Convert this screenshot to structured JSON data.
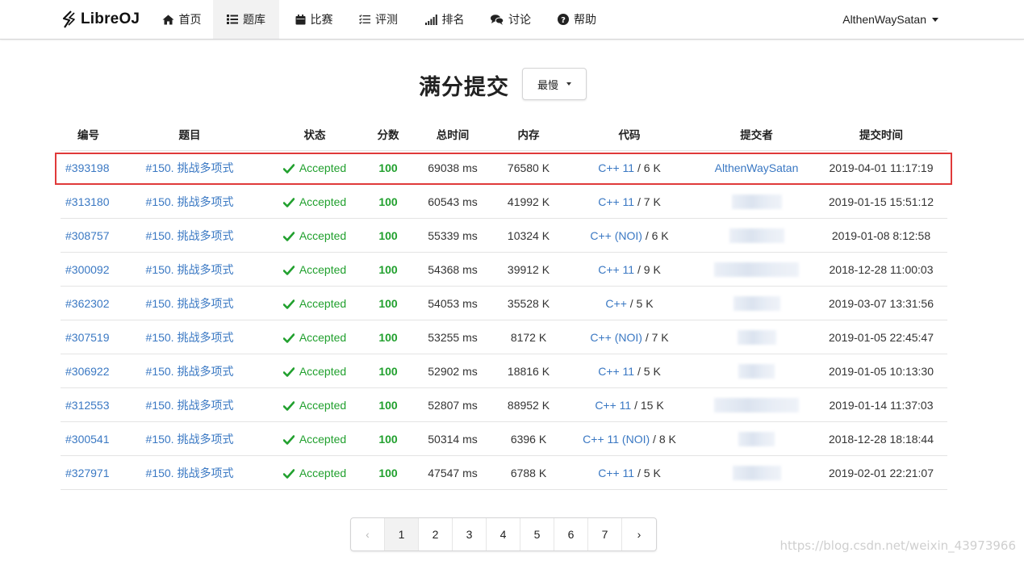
{
  "navbar": {
    "brand": "LibreOJ",
    "items": [
      {
        "label": "首页",
        "icon": "home-icon"
      },
      {
        "label": "题库",
        "icon": "list-icon"
      },
      {
        "label": "比赛",
        "icon": "calendar-icon"
      },
      {
        "label": "评测",
        "icon": "tasks-icon"
      },
      {
        "label": "排名",
        "icon": "signal-icon"
      },
      {
        "label": "讨论",
        "icon": "comments-icon"
      },
      {
        "label": "帮助",
        "icon": "help-icon"
      }
    ],
    "active_index": 1,
    "user": "AlthenWaySatan"
  },
  "heading": {
    "title": "满分提交",
    "sort_label": "最慢"
  },
  "table": {
    "headers": [
      "编号",
      "题目",
      "状态",
      "分数",
      "总时间",
      "内存",
      "代码",
      "提交者",
      "提交时间"
    ],
    "rows": [
      {
        "id": "#393198",
        "problem": "#150. 挑战多项式",
        "status": "Accepted",
        "score": "100",
        "time": "69038 ms",
        "memory": "76580 K",
        "lang": "C++ 11",
        "size": " / 6 K",
        "submitter": "AlthenWaySatan",
        "submitted": "2019-04-01 11:17:19"
      },
      {
        "id": "#313180",
        "problem": "#150. 挑战多项式",
        "status": "Accepted",
        "score": "100",
        "time": "60543 ms",
        "memory": "41992 K",
        "lang": "C++ 11",
        "size": " / 7 K",
        "submitter": "",
        "submitted": "2019-01-15 15:51:12"
      },
      {
        "id": "#308757",
        "problem": "#150. 挑战多项式",
        "status": "Accepted",
        "score": "100",
        "time": "55339 ms",
        "memory": "10324 K",
        "lang": "C++ (NOI)",
        "size": " / 6 K",
        "submitter": "",
        "submitted": "2019-01-08 8:12:58"
      },
      {
        "id": "#300092",
        "problem": "#150. 挑战多项式",
        "status": "Accepted",
        "score": "100",
        "time": "54368 ms",
        "memory": "39912 K",
        "lang": "C++ 11",
        "size": " / 9 K",
        "submitter": "",
        "submitted": "2018-12-28 11:00:03"
      },
      {
        "id": "#362302",
        "problem": "#150. 挑战多项式",
        "status": "Accepted",
        "score": "100",
        "time": "54053 ms",
        "memory": "35528 K",
        "lang": "C++",
        "size": " / 5 K",
        "submitter": "",
        "submitted": "2019-03-07 13:31:56"
      },
      {
        "id": "#307519",
        "problem": "#150. 挑战多项式",
        "status": "Accepted",
        "score": "100",
        "time": "53255 ms",
        "memory": "8172 K",
        "lang": "C++ (NOI)",
        "size": " / 7 K",
        "submitter": "",
        "submitted": "2019-01-05 22:45:47"
      },
      {
        "id": "#306922",
        "problem": "#150. 挑战多项式",
        "status": "Accepted",
        "score": "100",
        "time": "52902 ms",
        "memory": "18816 K",
        "lang": "C++ 11",
        "size": " / 5 K",
        "submitter": "",
        "submitted": "2019-01-05 10:13:30"
      },
      {
        "id": "#312553",
        "problem": "#150. 挑战多项式",
        "status": "Accepted",
        "score": "100",
        "time": "52807 ms",
        "memory": "88952 K",
        "lang": "C++ 11",
        "size": " / 15 K",
        "submitter": "",
        "submitted": "2019-01-14 11:37:03"
      },
      {
        "id": "#300541",
        "problem": "#150. 挑战多项式",
        "status": "Accepted",
        "score": "100",
        "time": "50314 ms",
        "memory": "6396 K",
        "lang": "C++ 11 (NOI)",
        "size": " / 8 K",
        "submitter": "",
        "submitted": "2018-12-28 18:18:44"
      },
      {
        "id": "#327971",
        "problem": "#150. 挑战多项式",
        "status": "Accepted",
        "score": "100",
        "time": "47547 ms",
        "memory": "6788 K",
        "lang": "C++ 11",
        "size": " / 5 K",
        "submitter": "",
        "submitted": "2019-02-01 22:21:07"
      }
    ],
    "highlighted_row": 0
  },
  "pagination": {
    "prev": "‹",
    "pages": [
      "1",
      "2",
      "3",
      "4",
      "5",
      "6",
      "7"
    ],
    "current": "1",
    "next": "›"
  },
  "watermark": "https://blog.csdn.net/weixin_43973966",
  "colors": {
    "link": "#3a78c3",
    "accepted": "#21a02e",
    "highlight_border": "#e03a3a"
  }
}
